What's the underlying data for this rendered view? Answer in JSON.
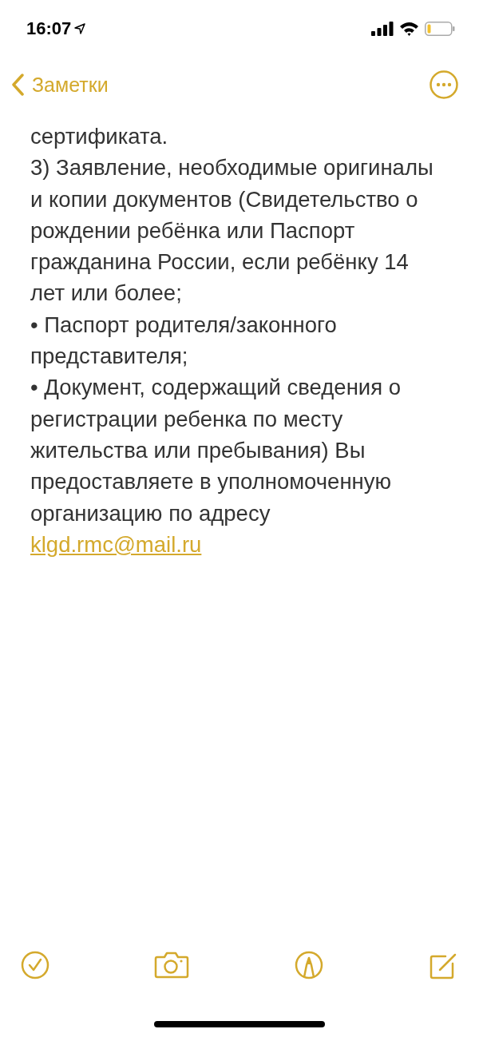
{
  "status_bar": {
    "time": "16:07"
  },
  "nav": {
    "back_label": "Заметки"
  },
  "note": {
    "lines": [
      {
        "kind": "text",
        "text": "сертификата."
      },
      {
        "kind": "text",
        "text": "3) Заявление, необходимые оригиналы"
      },
      {
        "kind": "text",
        "text": "и копии документов (Свидетельство о"
      },
      {
        "kind": "text",
        "text": "рождении ребёнка или Паспорт"
      },
      {
        "kind": "text",
        "text": "гражданина России, если ребёнку 14"
      },
      {
        "kind": "text",
        "text": "лет или более;"
      },
      {
        "kind": "text",
        "text": "• Паспорт родителя/законного"
      },
      {
        "kind": "text",
        "text": "представителя;"
      },
      {
        "kind": "text",
        "text": "• Документ, содержащий сведения о"
      },
      {
        "kind": "text",
        "text": "регистрации ребенка по месту"
      },
      {
        "kind": "text",
        "text": "жительства или пребывания) Вы"
      },
      {
        "kind": "text",
        "text": "предоставляете в уполномоченную"
      },
      {
        "kind": "text",
        "text": "организацию по адресу"
      },
      {
        "kind": "link",
        "text": "klgd.rmc@mail.ru"
      }
    ]
  }
}
